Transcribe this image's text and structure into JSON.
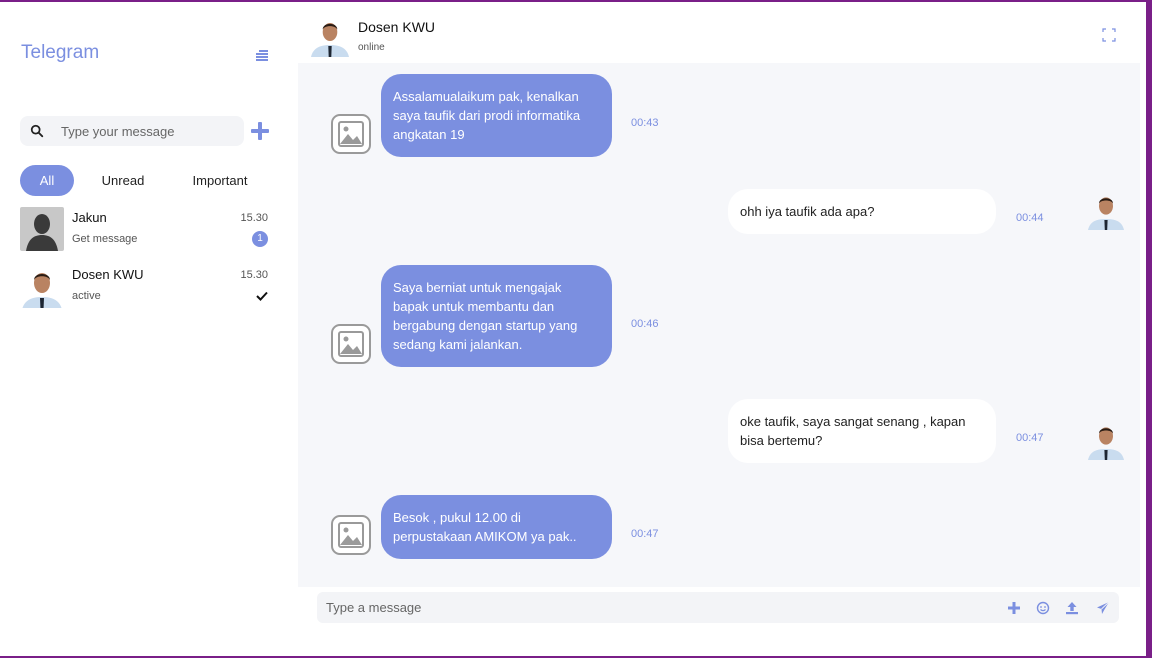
{
  "app": {
    "title": "Telegram"
  },
  "sidebar": {
    "search_placeholder": "Type your message",
    "tabs": [
      {
        "label": "All",
        "active": true
      },
      {
        "label": "Unread",
        "active": false
      },
      {
        "label": "Important",
        "active": false
      }
    ],
    "chats": [
      {
        "name": "Jakun",
        "subtitle": "Get message",
        "time": "15.30",
        "unread_count": "1",
        "avatar": "silhouette-avatar"
      },
      {
        "name": "Dosen KWU",
        "subtitle": "active",
        "time": "15.30",
        "read": true,
        "avatar": "man-avatar"
      }
    ]
  },
  "header": {
    "name": "Dosen KWU",
    "status": "online"
  },
  "messages": [
    {
      "direction": "in",
      "text": "Assalamualaikum pak, kenalkan saya taufik dari prodi informatika angkatan 19",
      "time": "00:43"
    },
    {
      "direction": "out",
      "text": "ohh iya taufik ada apa?",
      "time": "00:44"
    },
    {
      "direction": "in",
      "text": "Saya berniat untuk mengajak bapak untuk membantu dan bergabung dengan startup yang sedang kami jalankan.",
      "time": "00:46"
    },
    {
      "direction": "out",
      "text": "oke taufik, saya sangat senang , kapan bisa bertemu?",
      "time": "00:47"
    },
    {
      "direction": "in",
      "text": "Besok , pukul 12.00 di perpustakaan AMIKOM ya pak..",
      "time": "00:47"
    }
  ],
  "composer": {
    "placeholder": "Type a message"
  },
  "colors": {
    "accent": "#7b8fe0",
    "background": "#f6f7fa",
    "frame": "#7a1f88"
  }
}
